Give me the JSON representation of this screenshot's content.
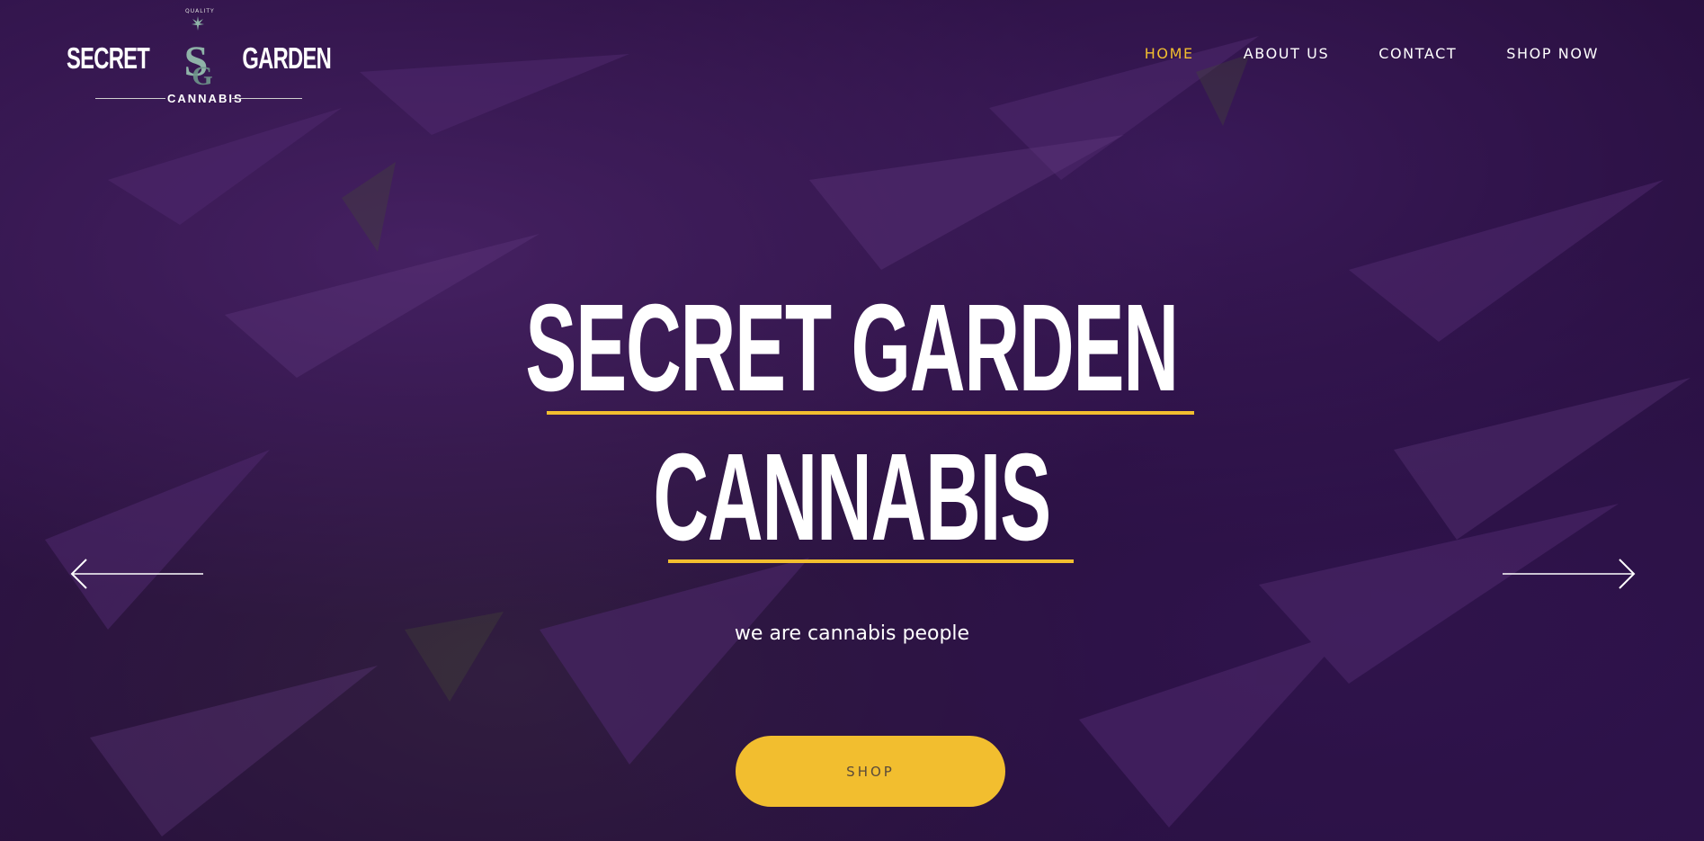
{
  "logo": {
    "quality": "QUALITY",
    "word_left": "SECRET",
    "word_right": "GARDEN",
    "monogram": "SG",
    "subtitle": "CANNABIS",
    "accent_color": "#8fb3a8"
  },
  "nav": {
    "items": [
      {
        "label": "HOME",
        "active": true
      },
      {
        "label": "ABOUT US",
        "active": false
      },
      {
        "label": "CONTACT",
        "active": false
      },
      {
        "label": "SHOP NOW",
        "active": false
      }
    ],
    "active_color": "#f2be2f"
  },
  "hero": {
    "title_line1": "SECRET GARDEN",
    "title_line2": "CANNABIS",
    "tagline": "we are cannabis people",
    "cta_label": "SHOP",
    "accent_color": "#f2be2f"
  },
  "slider": {
    "prev_icon": "arrow-left-icon",
    "next_icon": "arrow-right-icon"
  }
}
